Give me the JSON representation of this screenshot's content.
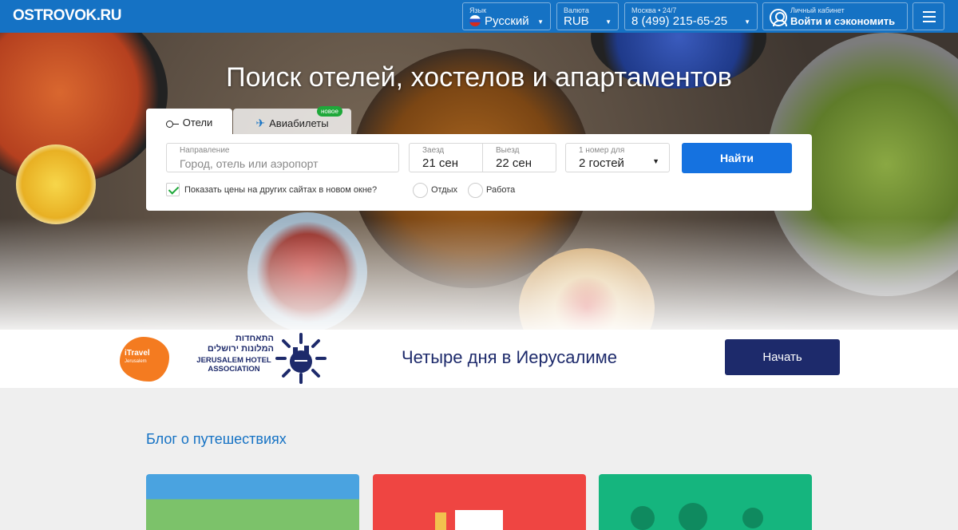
{
  "header": {
    "logo": "OSTROVOK.RU",
    "language": {
      "label": "Язык",
      "value": "Русский"
    },
    "currency": {
      "label": "Валюта",
      "value": "RUB"
    },
    "phone": {
      "label": "Москва • 24/7",
      "value": "8 (499) 215-65-25"
    },
    "account": {
      "label": "Личный кабинет",
      "value": "Войти и сэкономить"
    }
  },
  "hero": {
    "title": "Поиск отелей, хостелов и апартаментов"
  },
  "search": {
    "tabs": [
      {
        "label": "Отели",
        "icon": "key-icon"
      },
      {
        "label": "Авиабилеты",
        "icon": "plane-icon",
        "badge": "новое"
      }
    ],
    "destination": {
      "label": "Направление",
      "placeholder": "Город, отель или аэропорт"
    },
    "checkin": {
      "label": "Заезд",
      "value": "21 сен"
    },
    "checkout": {
      "label": "Выезд",
      "value": "22 сен"
    },
    "rooms": {
      "label": "1 номер для",
      "value": "2 гостей"
    },
    "submit": "Найти",
    "compare_checkbox": {
      "label": "Показать цены на других сайтах в новом окне?",
      "checked": true
    },
    "trip_types": [
      "Отдых",
      "Работа"
    ]
  },
  "promo": {
    "logo_itravel": "iTravel",
    "logo_itravel_sub": "Jerusalem",
    "association_hebrew_1": "התאחדות",
    "association_hebrew_2": "המלונות ירושלים",
    "association_en_1": "JERUSALEM HOTEL",
    "association_en_2": "ASSOCIATION",
    "text": "Четыре дня в Иерусалиме",
    "button": "Начать"
  },
  "blog": {
    "title": "Блог о путешествиях"
  },
  "colors": {
    "brand": "#1572c4",
    "search_button": "#1572e0",
    "promo_navy": "#1d2a6b",
    "badge_green": "#1fa83a"
  }
}
